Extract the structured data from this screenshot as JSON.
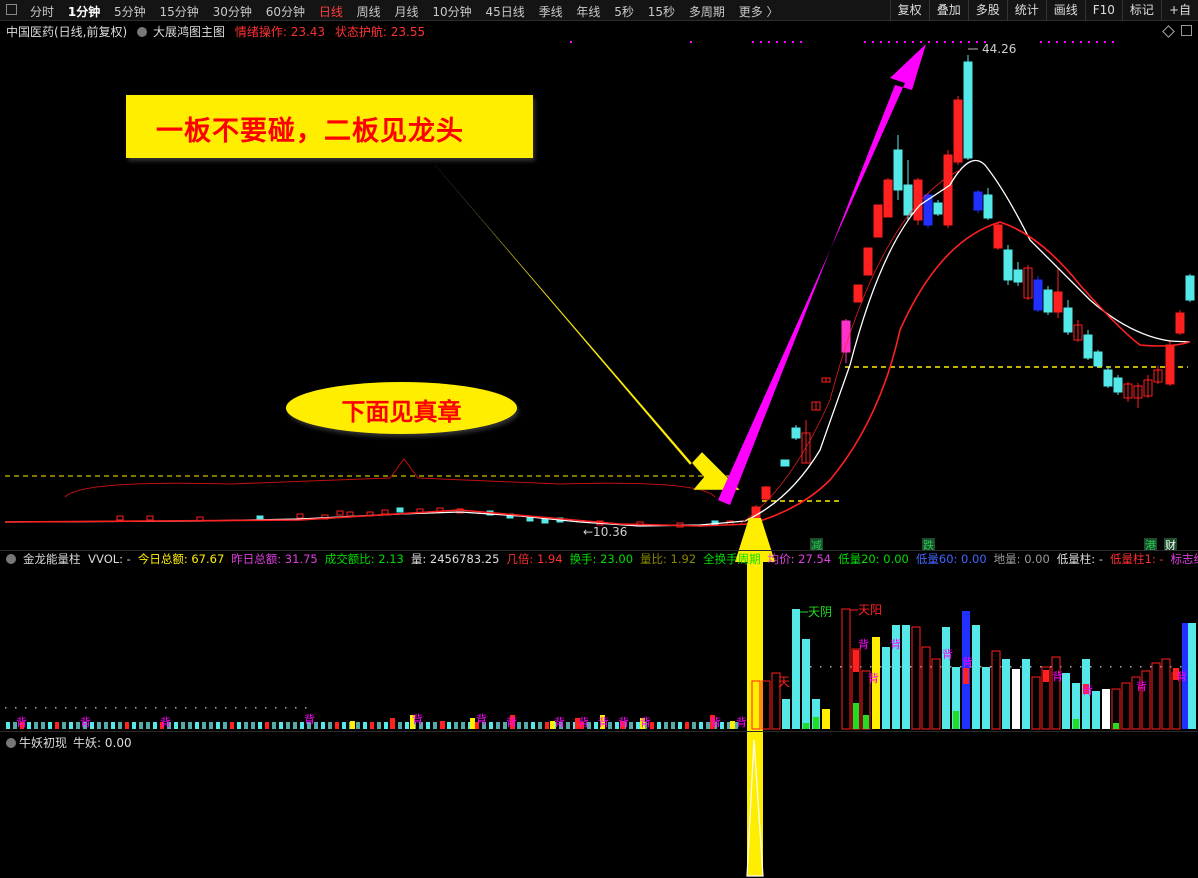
{
  "toolbar": {
    "tabs": [
      "分时",
      "1分钟",
      "5分钟",
      "15分钟",
      "30分钟",
      "60分钟",
      "日线",
      "周线",
      "月线",
      "10分钟",
      "45日线",
      "季线",
      "年线",
      "5秒",
      "15秒",
      "多周期",
      "更多 〉"
    ],
    "active_tab": "日线",
    "tools": [
      "复权",
      "叠加",
      "多股",
      "统计",
      "画线",
      "F10",
      "标记",
      "+自"
    ]
  },
  "main_panel": {
    "stock_name": "中国医药(日线,前复权)",
    "indicator_name": "大展鸿图主图",
    "info1": "情绪操作: 23.43",
    "info2": "状态护航: 23.55",
    "price_high": "44.26",
    "price_low": "10.36",
    "tags": [
      "减",
      "跌",
      "港",
      "财"
    ]
  },
  "annotations": {
    "callout_top": "一板不要碰，二板见龙头",
    "callout_bottom": "下面见真章"
  },
  "volume_panel": {
    "title": "金龙能量柱",
    "items": [
      {
        "label": "VVOL: -",
        "color": "#dddddd"
      },
      {
        "label": "今日总额: 67.67",
        "color": "#ffee00"
      },
      {
        "label": "昨日总额: 31.75",
        "color": "#e040e0"
      },
      {
        "label": "成交额比: 2.13",
        "color": "#00dd00"
      },
      {
        "label": "量: 2456783.25",
        "color": "#dddddd"
      },
      {
        "label": "几倍: 1.94",
        "color": "#ff3030"
      },
      {
        "label": "换手: 23.00",
        "color": "#00dd00"
      },
      {
        "label": "量比: 1.92",
        "color": "#888800"
      },
      {
        "label": "全换手周期",
        "color": "#00dd00"
      },
      {
        "label": "均价: 27.54",
        "color": "#e040e0"
      },
      {
        "label": "低量20: 0.00",
        "color": "#00dd00"
      },
      {
        "label": "低量60: 0.00",
        "color": "#4466ff"
      },
      {
        "label": "地量: 0.00",
        "color": "#999999"
      },
      {
        "label": "低量柱: -",
        "color": "#dddddd"
      },
      {
        "label": "低量柱1: -",
        "color": "#ff3030"
      },
      {
        "label": "标志线",
        "color": "#e040e0"
      }
    ],
    "marks": [
      "天阴",
      "天阳",
      "天",
      "背"
    ]
  },
  "niu_panel": {
    "title": "牛妖初现",
    "value": "牛妖: 0.00"
  },
  "colors": {
    "up": "#ff2020",
    "down": "#55e8e8",
    "blue": "#2030ff",
    "magenta": "#ff00ff",
    "yellow": "#ffee00"
  },
  "icons": [
    "panel-icon",
    "settings-circle-icon",
    "diamond-icon",
    "square-icon"
  ]
}
